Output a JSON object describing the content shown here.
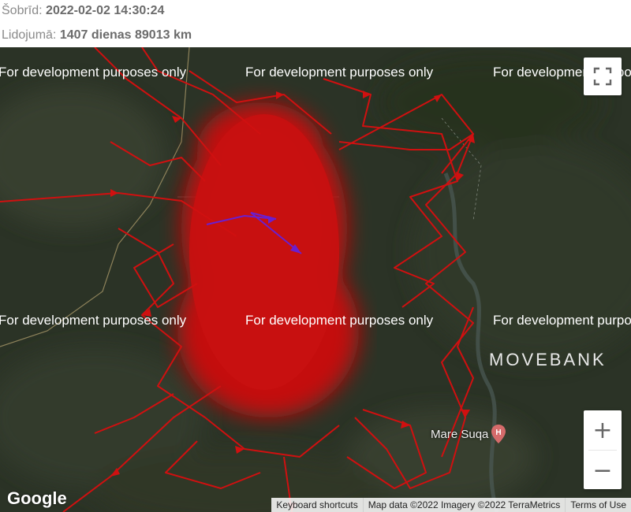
{
  "info": {
    "current_label": "Šobrīd:",
    "current_value": "2022-02-02 14:30:24",
    "flight_label": "Lidojumā:",
    "flight_value": "1407 dienas 89013 km"
  },
  "map": {
    "watermark_text": "For development purposes only",
    "movebank_logo": "MOVEBANK",
    "google_logo": "Google",
    "poi_label": "Mare Suqa",
    "poi_icon": "hospital-pin-icon",
    "controls": {
      "fullscreen_icon": "fullscreen-icon",
      "zoom_in_label": "+",
      "zoom_out_label": "−"
    },
    "attribution": {
      "keyboard": "Keyboard shortcuts",
      "map_data": "Map data ©2022 Imagery ©2022 TerraMetrics",
      "terms": "Terms of Use"
    },
    "colors": {
      "track": "#d01010",
      "current_track": "#6a1fd0",
      "satellite_base": "#2a3226"
    }
  }
}
